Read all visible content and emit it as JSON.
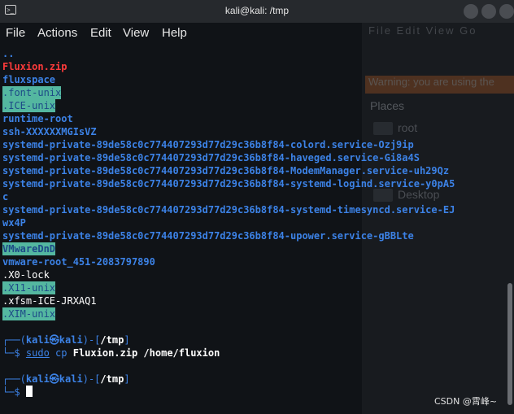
{
  "window": {
    "title": "kali@kali: /tmp"
  },
  "menu": [
    "File",
    "Actions",
    "Edit",
    "View",
    "Help"
  ],
  "listing": [
    {
      "text": "..",
      "style": "blue"
    },
    {
      "text": "Fluxion.zip",
      "style": "red"
    },
    {
      "text": "fluxspace",
      "style": "blue"
    },
    {
      "text": ".font-unix",
      "style": "hl"
    },
    {
      "text": ".ICE-unix",
      "style": "hl"
    },
    {
      "text": "runtime-root",
      "style": "blue"
    },
    {
      "text": "ssh-XXXXXXMGIsVZ",
      "style": "blue"
    },
    {
      "text": "systemd-private-89de58c0c774407293d77d29c36b8f84-colord.service-Ozj9ip",
      "style": "blue"
    },
    {
      "text": "systemd-private-89de58c0c774407293d77d29c36b8f84-haveged.service-Gi8a4S",
      "style": "blue"
    },
    {
      "text": "systemd-private-89de58c0c774407293d77d29c36b8f84-ModemManager.service-uh29Qz",
      "style": "blue"
    },
    {
      "text": "systemd-private-89de58c0c774407293d77d29c36b8f84-systemd-logind.service-y0pA5",
      "style": "blue"
    },
    {
      "text": "c",
      "style": "blue"
    },
    {
      "text": "systemd-private-89de58c0c774407293d77d29c36b8f84-systemd-timesyncd.service-EJ",
      "style": "blue"
    },
    {
      "text": "wx4P",
      "style": "blue"
    },
    {
      "text": "systemd-private-89de58c0c774407293d77d29c36b8f84-upower.service-gBBLte",
      "style": "blue"
    },
    {
      "text": "VMwareDnD",
      "style": "hl-b"
    },
    {
      "text": "vmware-root_451-2083797890",
      "style": "blue"
    },
    {
      "text": ".X0-lock",
      "style": "white"
    },
    {
      "text": ".X11-unix",
      "style": "hl"
    },
    {
      "text": ".xfsm-ICE-JRXAQ1",
      "style": "white"
    },
    {
      "text": ".XIM-unix",
      "style": "hl"
    }
  ],
  "prompt1": {
    "top": "┌──(",
    "user": "kali㉿kali",
    "mid": ")-[",
    "cwd": "/tmp",
    "end": "]",
    "bottom": "└─$ ",
    "cmd_first": "sudo",
    "cmd_cp": " cp ",
    "cmd_rest": "Fluxion.zip /home/fluxion"
  },
  "prompt2": {
    "top": "┌──(",
    "user": "kali㉿kali",
    "mid": ")-[",
    "cwd": "/tmp",
    "end": "]",
    "bottom": "└─$ "
  },
  "background_window": {
    "menu": "File  Edit  View  Go",
    "warning": "Warning: you are using the",
    "places": "Places",
    "items": [
      "root",
      "Desktop"
    ]
  },
  "watermark": "CSDN @霄峰~"
}
